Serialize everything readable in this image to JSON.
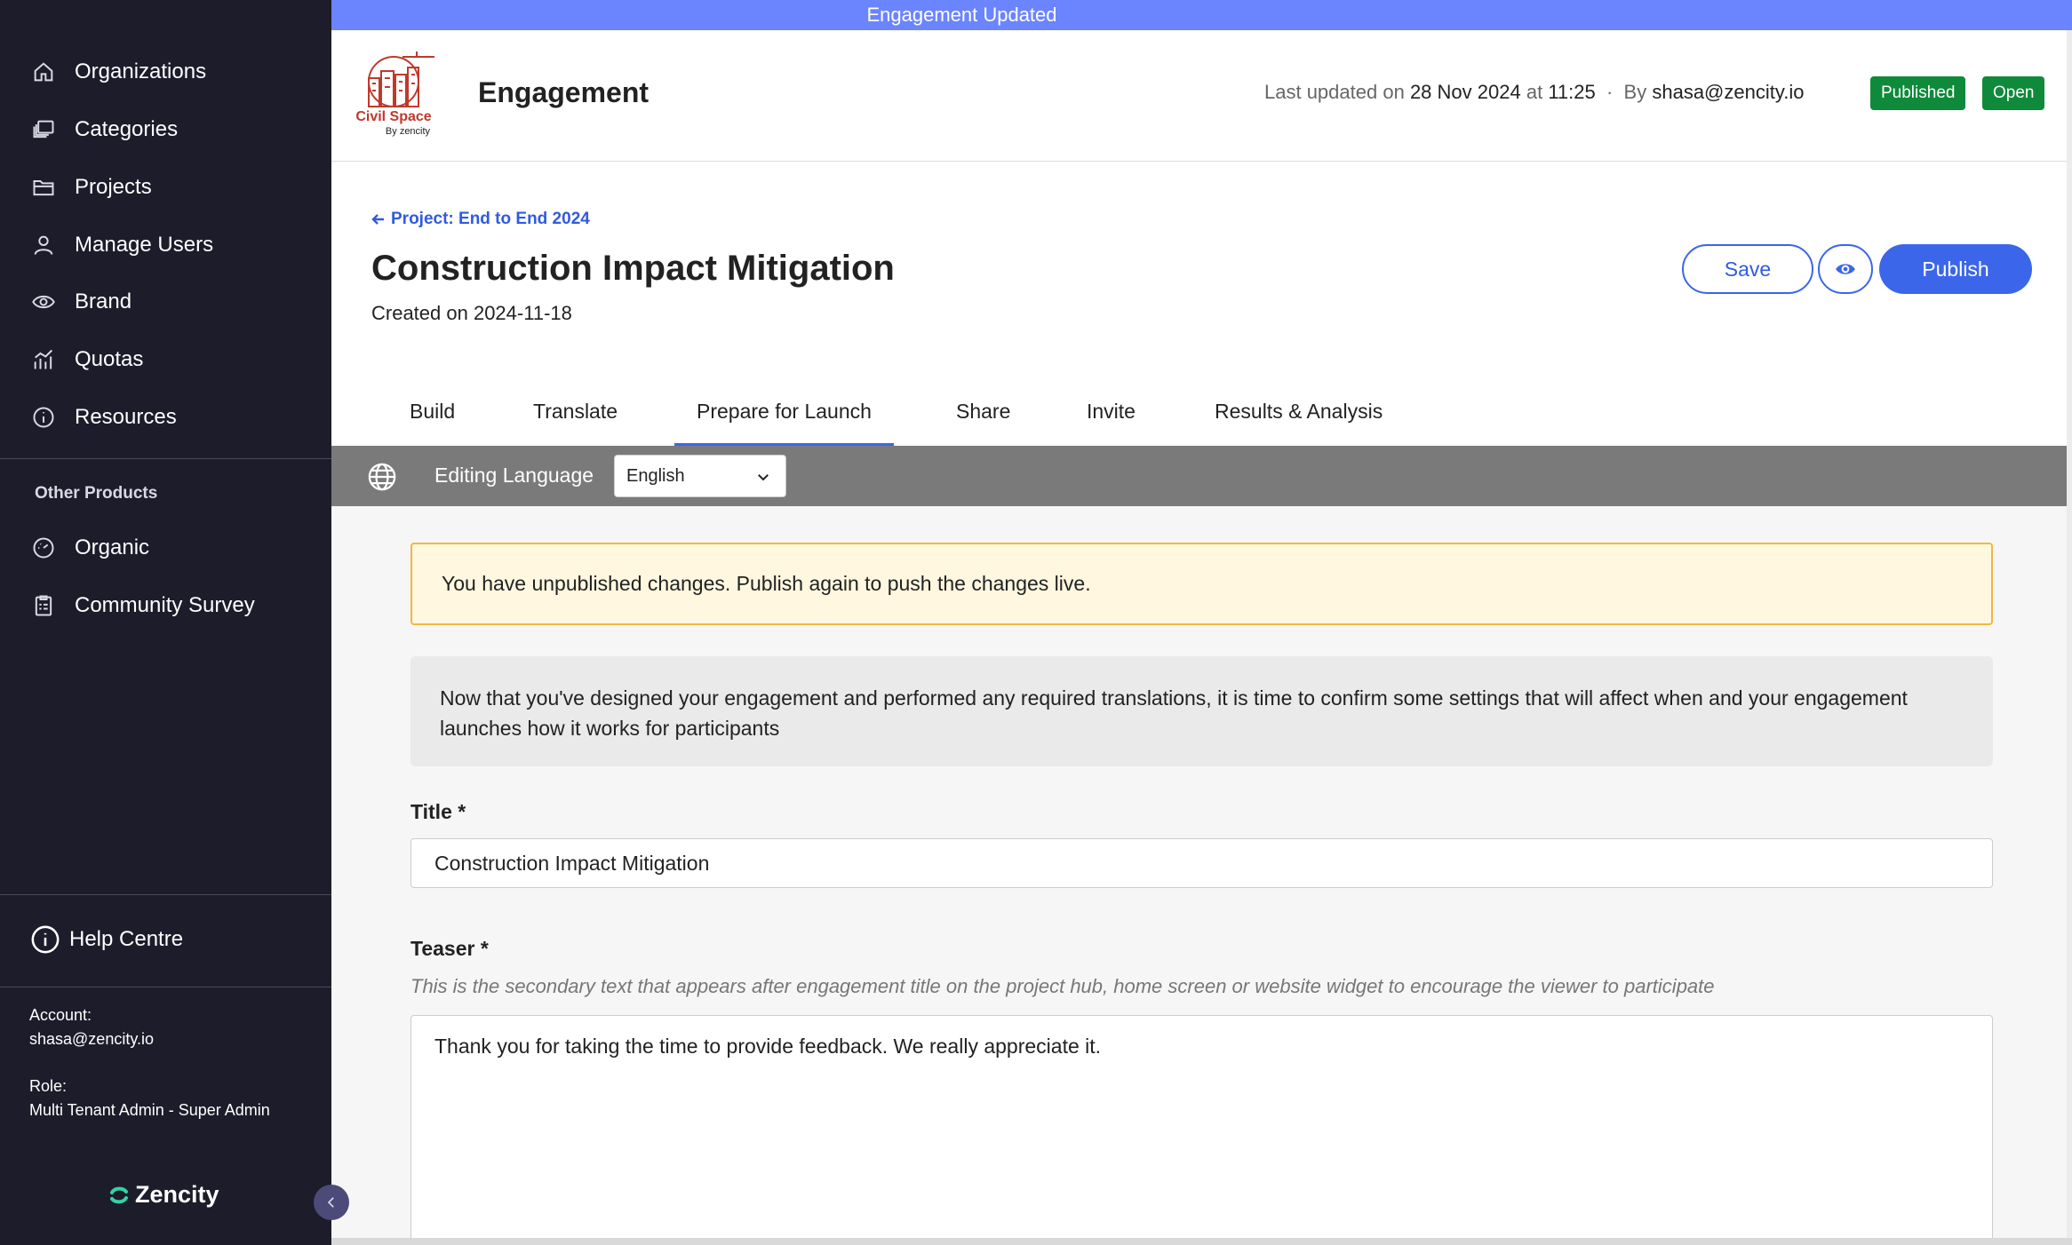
{
  "banner": {
    "text": "Engagement Updated"
  },
  "sidebar": {
    "items": [
      {
        "label": "Organizations",
        "icon": "home-icon"
      },
      {
        "label": "Categories",
        "icon": "categories-icon"
      },
      {
        "label": "Projects",
        "icon": "folder-icon"
      },
      {
        "label": "Manage Users",
        "icon": "user-icon"
      },
      {
        "label": "Brand",
        "icon": "eye-icon"
      },
      {
        "label": "Quotas",
        "icon": "chart-icon"
      },
      {
        "label": "Resources",
        "icon": "info-icon"
      }
    ],
    "other_products_title": "Other Products",
    "other_products": [
      {
        "label": "Organic",
        "icon": "gauge-icon"
      },
      {
        "label": "Community Survey",
        "icon": "clipboard-icon"
      }
    ],
    "help_label": "Help Centre",
    "account_label": "Account:",
    "account_value": "shasa@zencity.io",
    "role_label": "Role:",
    "role_value": "Multi Tenant Admin - Super Admin",
    "brand_name": "Zencity"
  },
  "header": {
    "logo_text": "Civil Space",
    "logo_sub": "By zencity",
    "title": "Engagement",
    "meta_prefix": "Last updated on",
    "meta_date": "28 Nov 2024",
    "meta_at": "at",
    "meta_time": "11:25",
    "meta_sep": "·",
    "meta_by": "By",
    "meta_user": "shasa@zencity.io",
    "badges": [
      "Published",
      "Open"
    ],
    "badge_color": "#0f8a3a"
  },
  "page": {
    "back_link": "Project: End to End 2024",
    "title": "Construction Impact Mitigation",
    "created": "Created on 2024-11-18",
    "save_label": "Save",
    "publish_label": "Publish",
    "accent": "#3b66ea"
  },
  "tabs": [
    "Build",
    "Translate",
    "Prepare for Launch",
    "Share",
    "Invite",
    "Results & Analysis"
  ],
  "active_tab": "Prepare for Launch",
  "language_bar": {
    "label": "Editing Language",
    "selected": "English"
  },
  "content": {
    "warning": "You have unpublished changes. Publish again to push the changes live.",
    "info": "Now that you've designed your engagement and performed any required translations, it is time to confirm some settings that will affect when and your engagement launches how it works for participants",
    "title_label": "Title *",
    "title_value": "Construction Impact Mitigation",
    "teaser_label": "Teaser *",
    "teaser_hint": "This is the secondary text that appears after engagement title on the project hub, home screen or website widget to encourage the viewer to participate",
    "teaser_value": "Thank you for taking the time to provide feedback. We really appreciate it."
  }
}
